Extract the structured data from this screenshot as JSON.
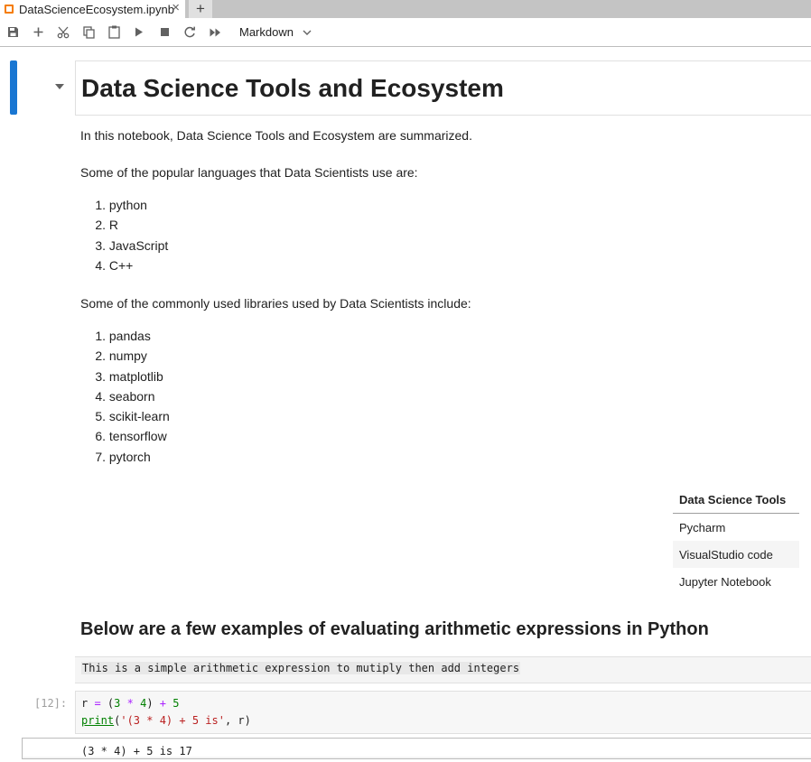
{
  "tab": {
    "title": "DataScienceEcosystem.ipynb",
    "close": "×",
    "new_tab": "+"
  },
  "toolbar": {
    "buttons": [
      "save-icon",
      "add-cell-icon",
      "cut-icon",
      "copy-icon",
      "paste-icon",
      "run-icon",
      "stop-icon",
      "restart-icon",
      "run-all-icon"
    ],
    "cell_type": "Markdown"
  },
  "notebook": {
    "title": "Data Science Tools and Ecosystem",
    "intro": "In this notebook, Data Science Tools and Ecosystem are summarized.",
    "languages_intro": "Some of the popular languages that Data Scientists use are:",
    "languages": [
      {
        "n": "1.",
        "t": "python"
      },
      {
        "n": "2.",
        "t": "R"
      },
      {
        "n": "3.",
        "t": "JavaScript"
      },
      {
        "n": "4.",
        "t": "C++"
      }
    ],
    "libraries_intro": "Some of the commonly used libraries used by Data Scientists include:",
    "libraries": [
      {
        "n": "1.",
        "t": "pandas"
      },
      {
        "n": "2.",
        "t": "numpy"
      },
      {
        "n": "3.",
        "t": "matplotlib"
      },
      {
        "n": "4.",
        "t": "seaborn"
      },
      {
        "n": "5.",
        "t": "scikit-learn"
      },
      {
        "n": "6.",
        "t": "tensorflow"
      },
      {
        "n": "7.",
        "t": "pytorch"
      }
    ],
    "tools_table": {
      "header": "Data Science Tools",
      "rows": [
        "Pycharm",
        "VisualStudio code",
        "Jupyter Notebook"
      ]
    },
    "examples_heading": "Below are a few examples of evaluating arithmetic expressions in Python",
    "inline_code": "This is a simple arithmetic expression to mutiply then add integers",
    "code_cell": {
      "prompt": "[12]:",
      "line1": "r = (3 * 4) + 5",
      "line2": "print('(3 * 4) + 5 is', r)",
      "output": "(3 * 4) + 5 is 17"
    }
  }
}
